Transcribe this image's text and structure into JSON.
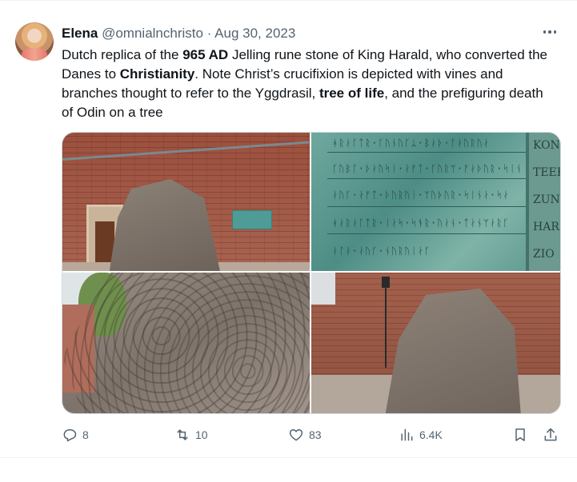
{
  "tweet": {
    "author_name": "Elena",
    "handle": "@omnialnchristo",
    "separator": "·",
    "date": "Aug 30, 2023",
    "text_segments": [
      {
        "t": "Dutch replica of the ",
        "bold": false
      },
      {
        "t": "965 AD",
        "bold": true
      },
      {
        "t": " Jelling rune stone of King Harald, who converted the Danes to ",
        "bold": false
      },
      {
        "t": "Christianity",
        "bold": true
      },
      {
        "t": ". Note Christ’s crucifixion is depicted with vines and branches thought to refer to the Yggdrasil, ",
        "bold": false
      },
      {
        "t": "tree of life",
        "bold": true
      },
      {
        "t": ", and the prefiguring death of Odin on a tree",
        "bold": false
      }
    ]
  },
  "media": {
    "plaque_runes": [
      "ᚼᚱᛅᚴᛏᚱ·ᚴᚢᚾᚢᚴᛦ·ᛒᛅᚦ·ᚴᛅᚢᚱᚢᛅ",
      "ᚴᚢᛒᛚ·ᚦᛅᚢᛋᛁ·ᛅᚠᛏ·ᚴᚢᚱᛘ·ᚠᛅᚦᚢᚱ·ᛋᛁᚾ",
      "ᛅᚢᚴ·ᛅᚠᛏ·ᚦᚢᚱᚢᛁ·ᛘᚢᚦᚢᚱ·ᛋᛁᚾᛅ·ᛋᛅ",
      "ᚼᛅᚱᛅᛚᛏᚱ·ᛁᛅᛋ·ᛋᚬᚱ·ᚢᛅᚾ·ᛏᛅᚾᛘᛅᚱᚴ",
      "ᛅᛚᛅ·ᛅᚢᚴ·ᚾᚢᚱᚢᛁᛅᚴ"
    ],
    "plaque_side_text": [
      "KON",
      "TEEK",
      "ZUN",
      "HAR",
      "ZIO"
    ]
  },
  "actions": {
    "replies": "8",
    "reposts": "10",
    "likes": "83",
    "views": "6.4K"
  },
  "icons": {
    "reply": "reply-icon",
    "repost": "repost-icon",
    "like": "heart-icon",
    "views": "views-chart-icon",
    "bookmark": "bookmark-icon",
    "share": "share-icon",
    "more": "more-dots-icon"
  },
  "colors": {
    "text": "#0f1419",
    "muted": "#536471",
    "border": "#cfd9de"
  }
}
